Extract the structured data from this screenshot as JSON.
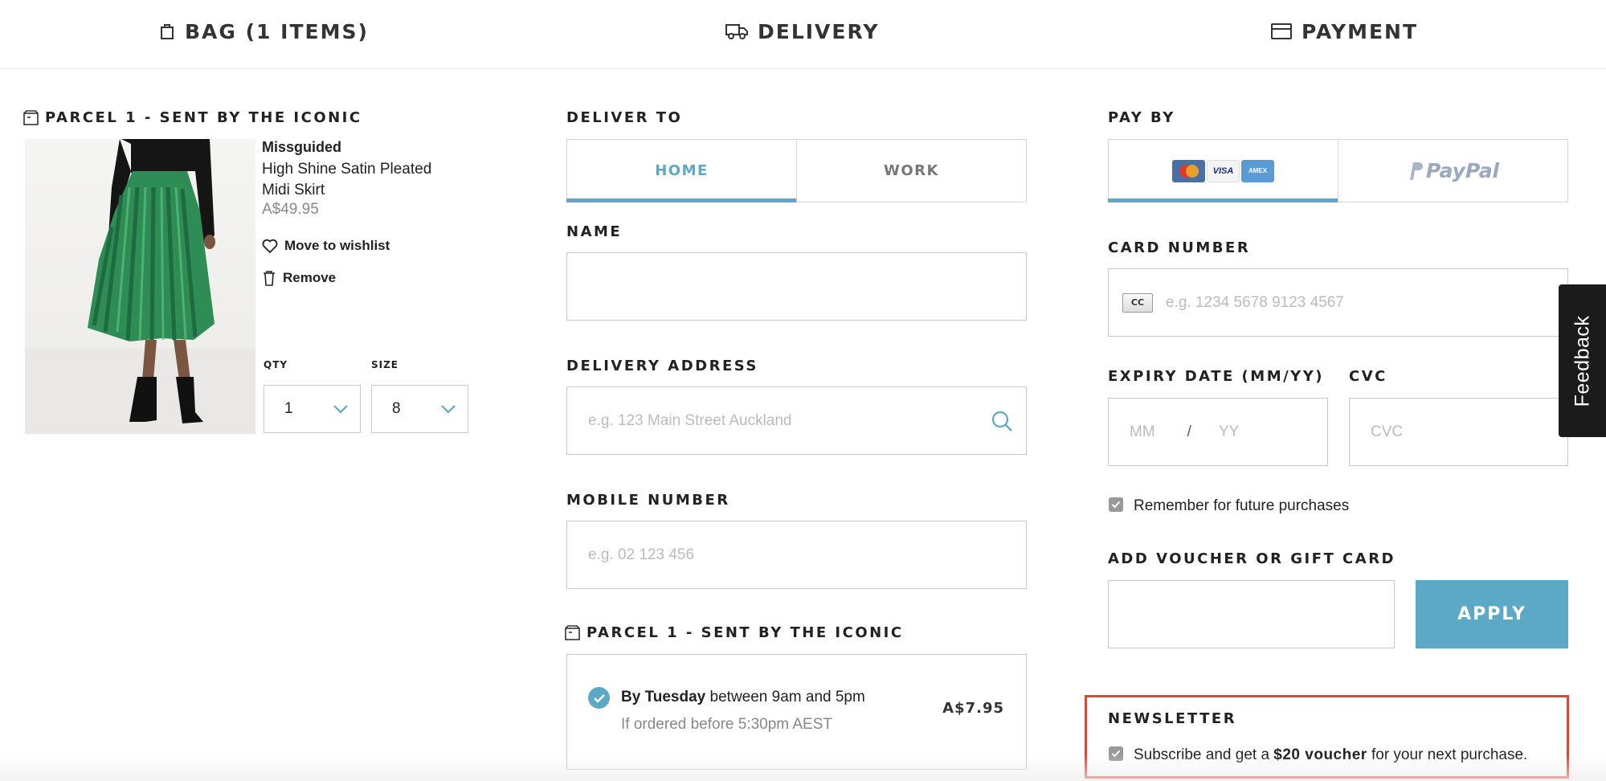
{
  "steps": {
    "bag": "BAG (1 ITEMS)",
    "delivery": "DELIVERY",
    "payment": "PAYMENT"
  },
  "bag": {
    "parcel_heading": "PARCEL 1 - SENT BY THE ICONIC",
    "item": {
      "brand": "Missguided",
      "name": "High Shine Satin Pleated Midi Skirt",
      "price": "A$49.95",
      "wishlist_label": "Move to wishlist",
      "remove_label": "Remove",
      "qty_label": "QTY",
      "qty_value": "1",
      "size_label": "SIZE",
      "size_value": "8"
    }
  },
  "delivery": {
    "deliver_to_heading": "DELIVER TO",
    "tabs": [
      {
        "label": "HOME",
        "active": true
      },
      {
        "label": "WORK",
        "active": false
      }
    ],
    "name_label": "NAME",
    "name_value": "",
    "address_label": "DELIVERY ADDRESS",
    "address_placeholder": "e.g. 123 Main Street Auckland",
    "mobile_label": "MOBILE NUMBER",
    "mobile_placeholder": "e.g. 02 123 456",
    "parcel_heading": "PARCEL 1 - SENT BY THE ICONIC",
    "shipping_option": {
      "day": "By Tuesday",
      "window": " between 9am and 5pm",
      "note": "If ordered before 5:30pm AEST",
      "price": "A$7.95",
      "selected": true
    }
  },
  "payment": {
    "pay_by_heading": "PAY BY",
    "cards": {
      "mastercard": "MC",
      "visa": "VISA",
      "amex": "AMEX"
    },
    "paypal_label": "PayPal",
    "card_number_label": "CARD NUMBER",
    "cc_badge": "CC",
    "card_number_placeholder": "e.g. 1234 5678 9123 4567",
    "expiry_label": "EXPIRY DATE (MM/YY)",
    "expiry_mm_placeholder": "MM",
    "expiry_separator": "/",
    "expiry_yy_placeholder": "YY",
    "cvc_label": "CVC",
    "cvc_placeholder": "CVC",
    "remember_label": "Remember for future purchases",
    "remember_checked": true,
    "voucher_label": "ADD VOUCHER OR GIFT CARD",
    "voucher_value": "",
    "apply_label": "APPLY"
  },
  "newsletter": {
    "heading": "NEWSLETTER",
    "text_before": "Subscribe and get a ",
    "text_bold": "$20 voucher",
    "text_after": " for your next purchase.",
    "checked": true
  },
  "feedback_label": "Feedback",
  "colors": {
    "accent": "#5ba9c7",
    "highlight_border": "#e0472f",
    "feedback_bg": "#1b1b1b"
  }
}
